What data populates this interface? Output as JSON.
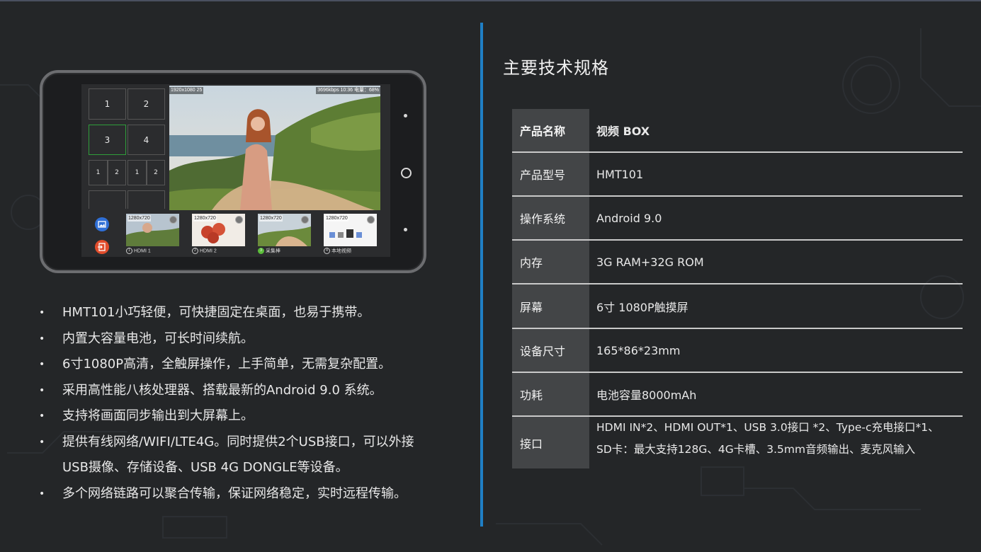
{
  "device": {
    "grid_cells": [
      "1",
      "2",
      "3",
      "4"
    ],
    "small_cells": [
      "1",
      "2",
      "1",
      "2"
    ],
    "overlay_left": "1920x1080  25",
    "overlay_right": "3696kbps  10:36  电量：68%",
    "thumbs": [
      {
        "res": "1280x720",
        "num": "1",
        "label": "HDMI 1"
      },
      {
        "res": "1280x720",
        "num": "2",
        "label": "HDMI 2"
      },
      {
        "res": "1280x720",
        "num": "3",
        "label": "采集棒"
      },
      {
        "res": "1280x720",
        "num": "4",
        "label": "本地视频"
      }
    ]
  },
  "features": [
    "HMT101小巧轻便，可快捷固定在桌面，也易于携带。",
    "内置大容量电池，可长时间续航。",
    "6寸1080P高清，全触屏操作，上手简单，无需复杂配置。",
    "采用高性能八核处理器、搭载最新的Android 9.0 系统。",
    "支持将画面同步输出到大屏幕上。",
    "提供有线网络/WIFI/LTE4G。同时提供2个USB接口，可以外接",
    "USB摄像、存储设备、USB 4G DONGLE等设备。",
    "多个网络链路可以聚合传输，保证网络稳定，实时远程传输。"
  ],
  "bullet": "•",
  "spec_title": "主要技术规格",
  "spec": [
    {
      "key": "产品名称",
      "value": "视频 BOX"
    },
    {
      "key": "产品型号",
      "value": "HMT101"
    },
    {
      "key": "操作系统",
      "value": "Android 9.0"
    },
    {
      "key": "内存",
      "value": "3G RAM+32G ROM"
    },
    {
      "key": "屏幕",
      "value": "6寸 1080P触摸屏"
    },
    {
      "key": "设备尺寸",
      "value": "165*86*23mm"
    },
    {
      "key": "功耗",
      "value": "电池容量8000mAh"
    },
    {
      "key": "接口",
      "value": "HDMI IN*2、HDMI OUT*1、USB 3.0接口 *2、Type-c充电接口*1、",
      "value2": "SD卡：最大支持128G、4G卡槽、3.5mm音频输出、麦克风输入"
    }
  ],
  "colors": {
    "accent": "#1f7fc5",
    "background": "#242628",
    "key_cell": "#434547"
  }
}
